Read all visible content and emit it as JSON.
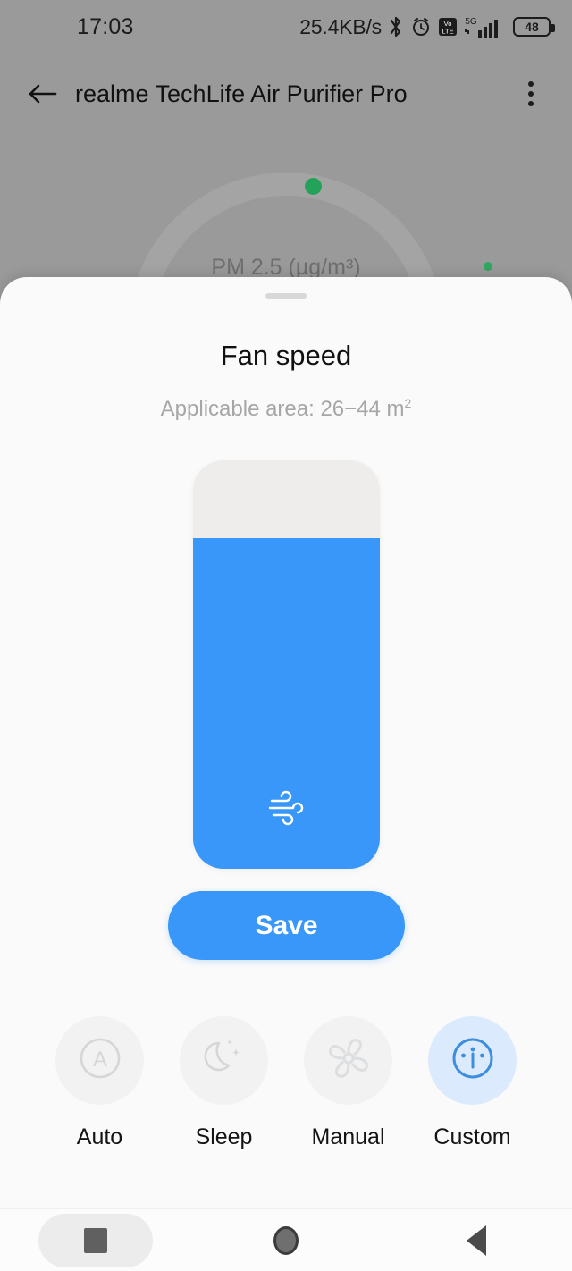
{
  "status_bar": {
    "time": "17:03",
    "network_speed": "25.4KB/s",
    "icons": [
      "bluetooth-icon",
      "alarm-icon",
      "volte-icon",
      "signal-5g-icon"
    ],
    "battery_level": "48"
  },
  "app_bar": {
    "back_label": "back-arrow-icon",
    "title": "realme TechLife Air Purifier Pro",
    "overflow_label": "more-options-icon"
  },
  "background": {
    "pm_label": "PM 2.5 (µg/m³)"
  },
  "sheet": {
    "title": "Fan speed",
    "subtitle_prefix": "Applicable area: 26−44 m",
    "subtitle_sup": "2",
    "slider": {
      "fill_percent": 81,
      "icon": "wind-icon",
      "track_color": "#eeedeb",
      "fill_color": "#3897f8"
    },
    "save_label": "Save",
    "modes": [
      {
        "label": "Auto",
        "icon": "auto-mode-icon",
        "selected": false
      },
      {
        "label": "Sleep",
        "icon": "sleep-mode-icon",
        "selected": false
      },
      {
        "label": "Manual",
        "icon": "manual-mode-icon",
        "selected": false
      },
      {
        "label": "Custom",
        "icon": "custom-mode-icon",
        "selected": true
      }
    ]
  },
  "nav_bar": {
    "recents": "recents-button",
    "home": "home-button",
    "back": "back-button"
  },
  "colors": {
    "accent": "#3897f8",
    "selected_bg": "#dbeafc",
    "sheet_bg": "#fafafa",
    "scrim": "#9a9a9a",
    "indicator_green": "#23a35a"
  }
}
